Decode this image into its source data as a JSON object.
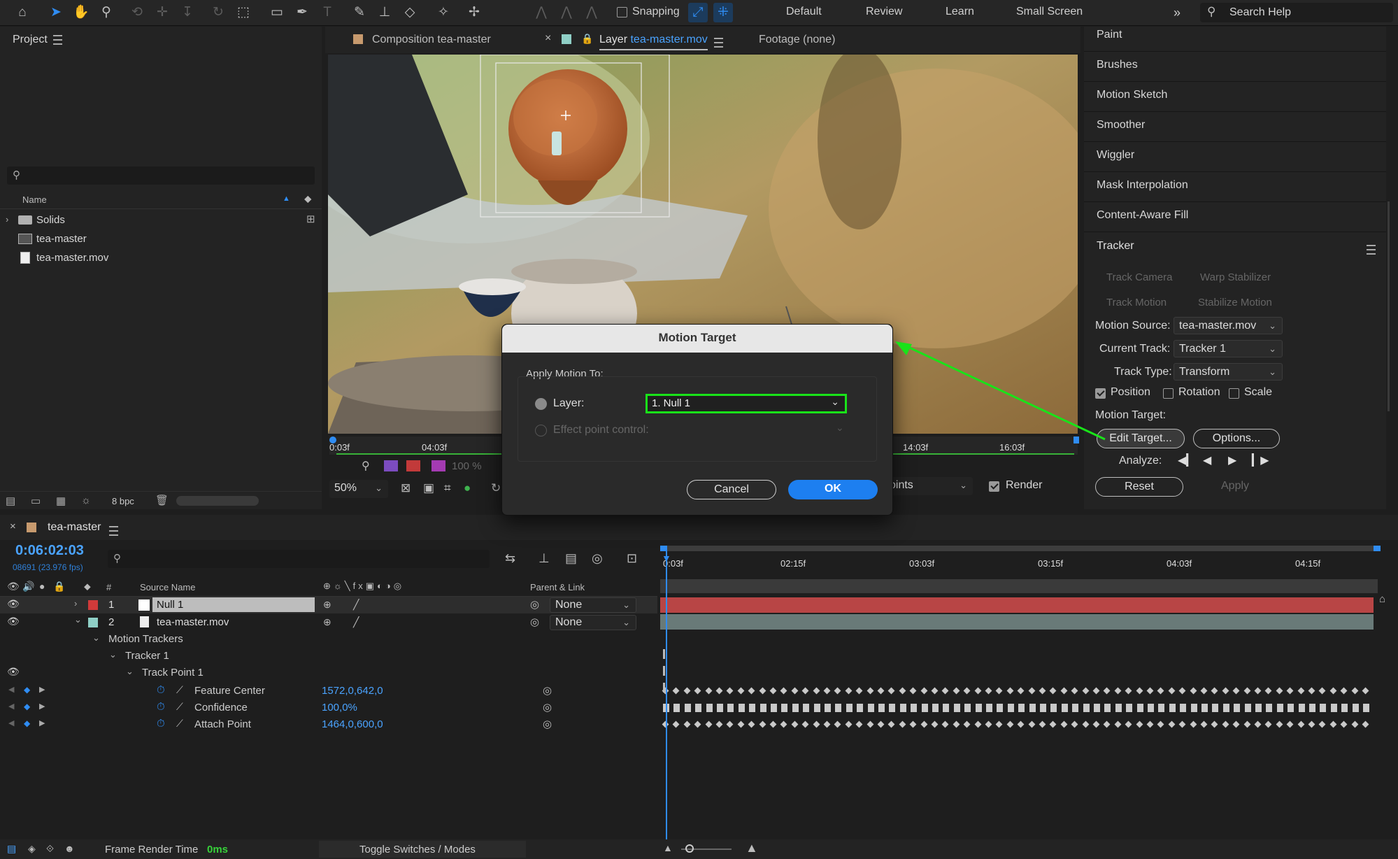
{
  "toolbar": {
    "snapping_label": "Snapping",
    "workspaces": [
      "Default",
      "Review",
      "Learn",
      "Small Screen"
    ],
    "search_placeholder": "Search Help"
  },
  "project": {
    "title": "Project",
    "column_name": "Name",
    "items": [
      {
        "name": "Solids",
        "type": "folder"
      },
      {
        "name": "tea-master",
        "type": "composition"
      },
      {
        "name": "tea-master.mov",
        "type": "footage"
      }
    ],
    "bpc": "8 bpc"
  },
  "viewer": {
    "tabs": [
      {
        "label": "Composition tea-master"
      },
      {
        "label_prefix": "Layer",
        "label": "tea-master.mov"
      },
      {
        "label": "Footage (none)"
      }
    ],
    "ruler_labels": [
      "0:03f",
      "04:03f",
      "14:03f",
      "16:03f"
    ],
    "zoom": "50%",
    "opacity": "100 %",
    "view_mode": "oints",
    "render_label": "Render"
  },
  "dialog": {
    "title": "Motion Target",
    "group_label": "Apply Motion To:",
    "layer_label": "Layer:",
    "layer_value": "1. Null 1",
    "effect_label": "Effect point control:",
    "cancel_label": "Cancel",
    "ok_label": "OK"
  },
  "right_panel": {
    "items": [
      "Paint",
      "Brushes",
      "Motion Sketch",
      "Smoother",
      "Wiggler",
      "Mask Interpolation",
      "Content-Aware Fill"
    ],
    "tracker": {
      "title": "Tracker",
      "track_camera": "Track Camera",
      "warp_stabilizer": "Warp Stabilizer",
      "track_motion": "Track Motion",
      "stabilize_motion": "Stabilize Motion",
      "motion_source_label": "Motion Source:",
      "motion_source_value": "tea-master.mov",
      "current_track_label": "Current Track:",
      "current_track_value": "Tracker 1",
      "track_type_label": "Track Type:",
      "track_type_value": "Transform",
      "position_label": "Position",
      "rotation_label": "Rotation",
      "scale_label": "Scale",
      "motion_target_label": "Motion Target:",
      "edit_target_label": "Edit Target...",
      "options_label": "Options...",
      "analyze_label": "Analyze:",
      "reset_label": "Reset",
      "apply_label": "Apply"
    }
  },
  "timeline": {
    "comp_name": "tea-master",
    "timecode": "0:06:02:03",
    "frame_info": "08691 (23.976 fps)",
    "col_hash": "#",
    "col_source": "Source Name",
    "col_parent": "Parent & Link",
    "ruler": [
      "0:03f",
      "02:15f",
      "03:03f",
      "03:15f",
      "04:03f",
      "04:15f"
    ],
    "layers": [
      {
        "num": "1",
        "name": "Null 1",
        "parent": "None"
      },
      {
        "num": "2",
        "name": "tea-master.mov",
        "parent": "None"
      }
    ],
    "motion_trackers": "Motion Trackers",
    "tracker": "Tracker 1",
    "track_point": "Track Point 1",
    "properties": [
      {
        "name": "Feature Center",
        "value": "1572,0,642,0"
      },
      {
        "name": "Confidence",
        "value": "100,0%"
      },
      {
        "name": "Attach Point",
        "value": "1464,0,600,0"
      }
    ],
    "frame_render_label": "Frame Render Time",
    "frame_render_value": "0ms",
    "toggle_label": "Toggle Switches / Modes"
  },
  "colors": {
    "accent": "#2f8cf2",
    "highlight_green": "#19e319",
    "null_label": "#d13a3a",
    "footage_label": "#8fcfc6"
  }
}
